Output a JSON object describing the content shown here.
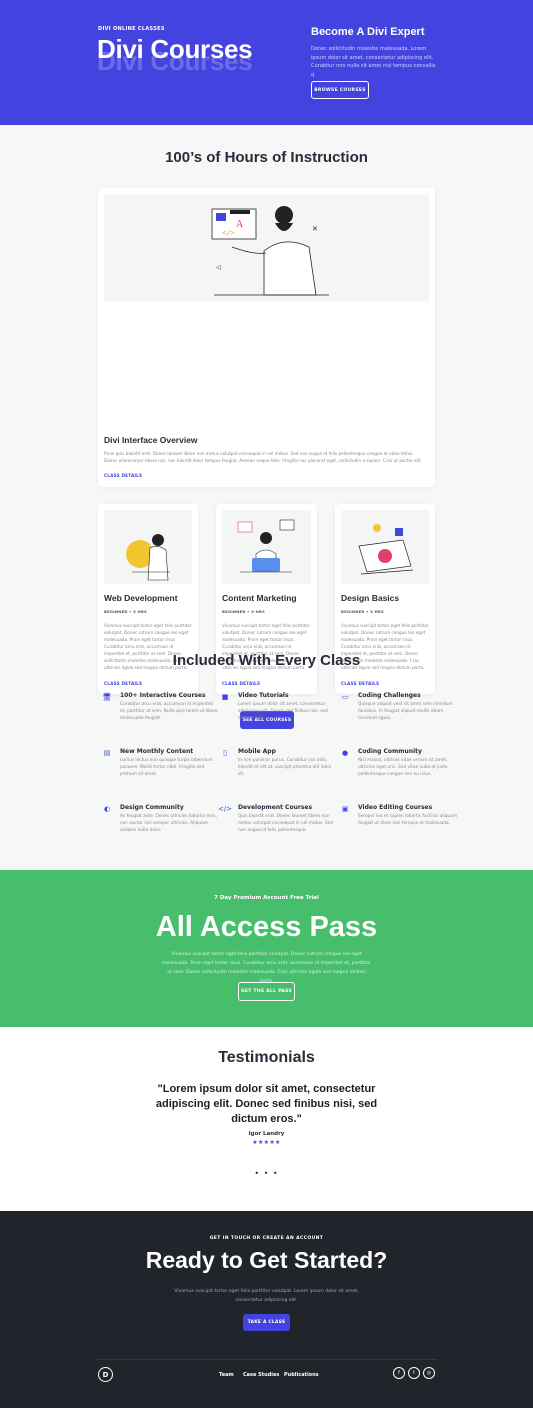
{
  "hero": {
    "eyebrow": "DIVI ONLINE CLASSES",
    "title": "Divi Courses",
    "side_title": "Become A Divi Expert",
    "side_text": "Donec sollicitudin molestie malesuada. Lorem ipsum dolor sit amet, consectetur adipiscing elit. Curabitur non nulla sit amet nisl tempus convallis q",
    "button": "BROWSE COURSES"
  },
  "instruction": {
    "title": "100’s of Hours of Instruction",
    "featured": {
      "title": "Divi Interface Overview",
      "text": "Proin quis blandit erat. Donec laoreet libero non metus volutpat consequat in vel metus. Sed non augue id felis pellentesque congue et vitae tellus. Donec ullamcorper libero nisl, nec blandit dolor tempus feugiat. Aenean neque felis, fringilla nec placerat eget, sollicitudin a sapien. Cras ut auctor elit.",
      "link": "CLASS DETAILS"
    },
    "courses": [
      {
        "title": "Web Development",
        "meta": "BEGINNER • 3 HRS",
        "text": "Vivamus suscipit tortor eget felis porttitor volutpat. Donec rutrum congue leo eget malesuada. Proin eget tortor risus. Curabitur arcu erat, accumsan id imperdiet et, porttitor at sem. Donec sollicitudin molestie malesuada. Cras ultricies ligula sed magna dictum porta.",
        "link": "CLASS DETAILS"
      },
      {
        "title": "Content Marketing",
        "meta": "BEGINNER • 3 HRS",
        "text": "Vivamus suscipit tortor eget felis porttitor volutpat. Donec rutrum congue leo eget malesuada. Proin eget tortor risus. Curabitur arcu erat, accumsan id imperdiet et, porttitor at sem. Donec sollicitudin molestie malesuada. Cras ultricies ligula sed magna dictum porta.",
        "link": "CLASS DETAILS"
      },
      {
        "title": "Design Basics",
        "meta": "BEGINNER • 3 HRS",
        "text": "Vivamus suscipit tortor eget felis porttitor volutpat. Donec rutrum congue leo eget malesuada. Proin eget tortor risus. Curabitur arcu erat, accumsan id imperdiet et, porttitor at sem. Donec sollicitudin molestie malesuada. Cras ultricies ligula sed magna dictum porta.",
        "link": "CLASS DETAILS"
      }
    ],
    "see_all": "SEE ALL COURSES"
  },
  "included": {
    "title": "Included With Every Class",
    "items": [
      {
        "icon": "monitor-icon",
        "title": "100+ Interactive Courses",
        "text": "Curabitur arcu erat, accumsan id imperdiet et, porttitor at sem. Nulla quis lorem ut libero malesuada feugiat."
      },
      {
        "icon": "video-icon",
        "title": "Video Tutorials",
        "text": "Lorem ipsum dolor sit amet, consectetur adipiscing elit. Donec sed finibus nisi, sed dictum eros."
      },
      {
        "icon": "laptop-icon",
        "title": "Coding Challenges",
        "text": "Quisque aliquet velit sit amet sem interdum faucibus. In feugiat aliquet mollis etiam tincidunt ligula."
      },
      {
        "icon": "book-icon",
        "title": "New Monthly Content",
        "text": "Luctus lectus non quisque turpis bibendum posuere. Morbi tortor nibh, fringilla sed pretium sit amet."
      },
      {
        "icon": "mobile-icon",
        "title": "Mobile App",
        "text": "In non pulvinar purus. Curabitur nisi odio, blandit et elit at, suscipit pharetra elit dolor sit."
      },
      {
        "icon": "users-icon",
        "title": "Coding Community",
        "text": "Nisl massa, ultrices vitae ornare sit amet, ultricies eget orci. Sed vitae nulla et justo pellentesque congue nec eu risus."
      },
      {
        "icon": "palette-icon",
        "title": "Design Community",
        "text": "Ac feugiat ante. Donec ultricies lobortis eros, nec auctor nisl semper ultricies. Aliquam sodales nulla dolor."
      },
      {
        "icon": "code-icon",
        "title": "Development Courses",
        "text": "Quis blandit erat. Donec laoreet libero non metus volutpat consequat in vel metus. Sed non augue id felis pellentesque."
      },
      {
        "icon": "image-icon",
        "title": "Video Editing Courses",
        "text": "Semper leo et sapien lobortis facilisis aliquam feugiat ut diam non tempus et malesuada."
      }
    ]
  },
  "pass": {
    "eyebrow": "7 Day Premium Account Free Trial",
    "title": "All Access Pass",
    "text": "Vivamus suscipit tortor eget felis porttitor volutpat. Donec rutrum congue leo eget malesuada. Proin eget tortor risus. Curabitur arcu erat, accumsan id imperdiet et, porttitor at sem. Donec sollicitudin molestie malesuada. Cras ultricies ligula sed magna dictum porta.",
    "button": "GET THE ALL PASS"
  },
  "testimonials": {
    "title": "Testimonials",
    "quote": "\"Lorem ipsum dolor sit amet, consectetur adipiscing elit. Donec sed finibus nisi, sed dictum eros.\"",
    "author": "Igor Landry",
    "stars": "★★★★★",
    "dots": "• • •"
  },
  "cta": {
    "eyebrow": "GET IN TOUCH OR CREATE AN ACCOUNT",
    "title": "Ready to Get Started?",
    "text": "Vivamus suscipit tortor eget felis porttitor volutpat. Lorem ipsum dolor sit amet, consectetur adipiscing elit.",
    "button": "TAKE A CLASS"
  },
  "footer": {
    "logo": "D",
    "nav": [
      "Team",
      "Case Studies",
      "Publications"
    ],
    "social": [
      {
        "icon": "facebook-icon",
        "glyph": "f"
      },
      {
        "icon": "twitter-icon",
        "glyph": "t"
      },
      {
        "icon": "instagram-icon",
        "glyph": "◎"
      }
    ]
  },
  "colors": {
    "primary": "#4343e0",
    "green": "#46be6b",
    "dark": "#22242b",
    "background": "#f5f8f7"
  }
}
